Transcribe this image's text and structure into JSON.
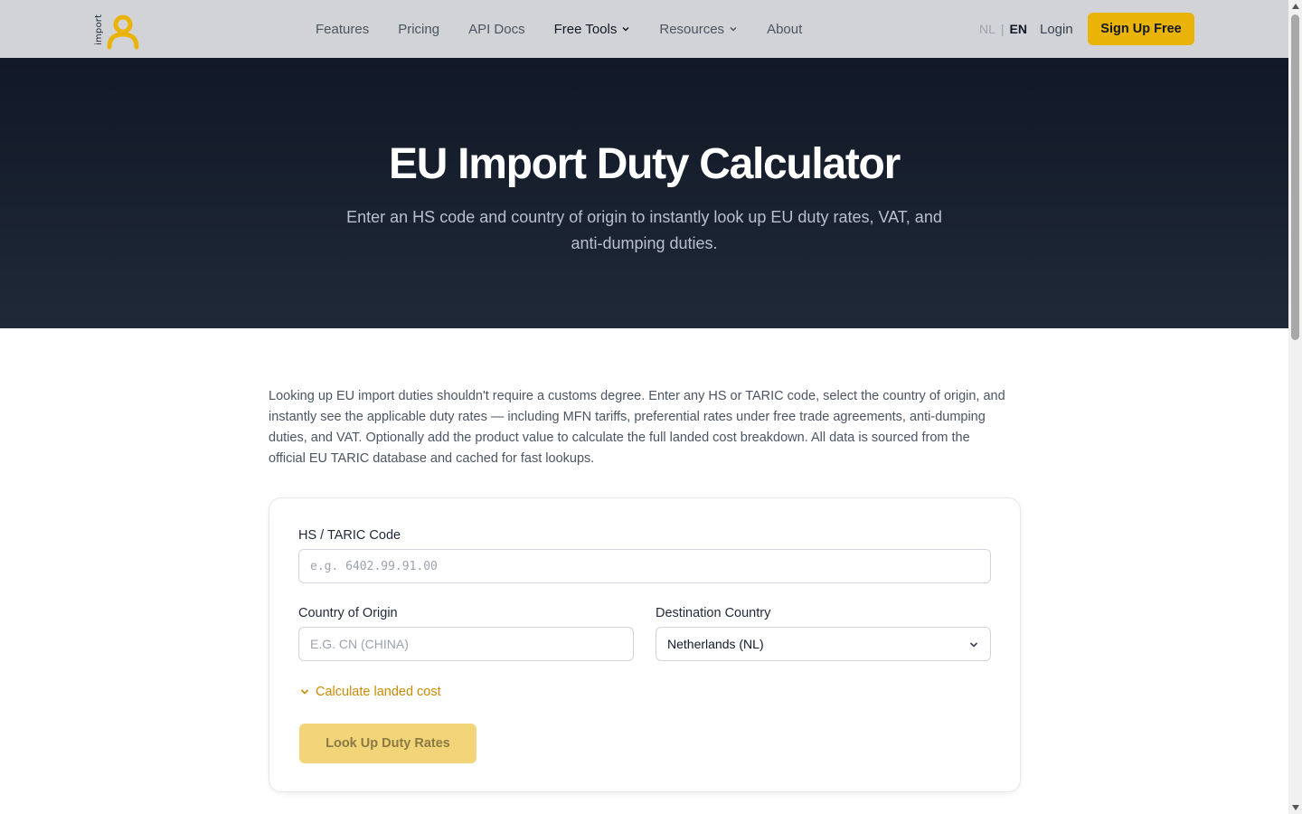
{
  "header": {
    "logo_text": "import",
    "nav": [
      {
        "label": "Features"
      },
      {
        "label": "Pricing"
      },
      {
        "label": "API Docs"
      },
      {
        "label": "Free Tools"
      },
      {
        "label": "Resources"
      },
      {
        "label": "About"
      }
    ],
    "lang_nl": "NL",
    "lang_sep": "|",
    "lang_en": "EN",
    "login": "Login",
    "signup": "Sign Up Free"
  },
  "hero": {
    "title": "EU Import Duty Calculator",
    "subtitle": "Enter an HS code and country of origin to instantly look up EU duty rates, VAT, and anti-dumping duties."
  },
  "intro": "Looking up EU import duties shouldn't require a customs degree. Enter any HS or TARIC code, select the country of origin, and instantly see the applicable duty rates — including MFN tariffs, preferential rates under free trade agreements, anti-dumping duties, and VAT. Optionally add the product value to calculate the full landed cost breakdown. All data is sourced from the official EU TARIC database and cached for fast lookups.",
  "form": {
    "hs_label": "HS / TARIC Code",
    "hs_placeholder": "e.g. 6402.99.91.00",
    "origin_label": "Country of Origin",
    "origin_placeholder": "E.G. CN (CHINA)",
    "dest_label": "Destination Country",
    "dest_value": "Netherlands (NL)",
    "landed_cost_toggle": "Calculate landed cost",
    "submit": "Look Up Duty Rates"
  },
  "colors": {
    "accent": "#eab308",
    "hero_bg": "#111827",
    "header_bg": "#d1d3d6"
  }
}
